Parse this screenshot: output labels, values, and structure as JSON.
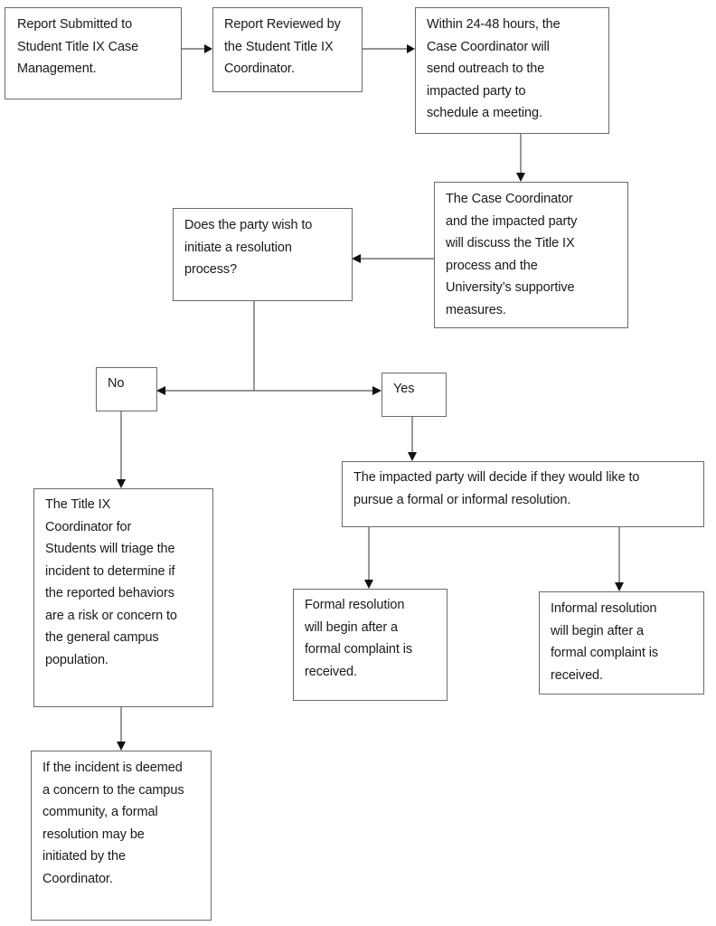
{
  "flowchart": {
    "nodes": {
      "report_submitted": {
        "text": "Report Submitted to\nStudent Title IX Case\nManagement."
      },
      "report_reviewed": {
        "text": "Report Reviewed by\nthe Student Title IX\nCoordinator."
      },
      "outreach": {
        "text": "Within 24-48 hours, the\nCase Coordinator will\nsend outreach to the\nimpacted party to\nschedule a meeting."
      },
      "discuss": {
        "text": "The Case Coordinator\nand the impacted party\nwill discuss the Title IX\nprocess and the\nUniversity’s supportive\nmeasures."
      },
      "decision": {
        "text": "Does the party wish to\ninitiate a resolution\nprocess?"
      },
      "no": {
        "text": "No"
      },
      "yes": {
        "text": "Yes"
      },
      "decide_type": {
        "text": "The impacted party will decide if they would like to\npursue a formal or informal resolution."
      },
      "triage": {
        "text": "The Title IX\nCoordinator for\nStudents will triage the\nincident to determine if\nthe reported behaviors\nare a risk or concern to\nthe general campus\npopulation."
      },
      "concern": {
        "text": "If the incident is deemed\na concern to the campus\ncommunity, a formal\nresolution may be\ninitiated by the\nCoordinator."
      },
      "formal": {
        "text": "Formal resolution\nwill begin after a\nformal complaint is\nreceived."
      },
      "informal": {
        "text": "Informal resolution\nwill begin after a\nformal complaint is\nreceived."
      }
    },
    "edges": [
      {
        "from": "report_submitted",
        "to": "report_reviewed"
      },
      {
        "from": "report_reviewed",
        "to": "outreach"
      },
      {
        "from": "outreach",
        "to": "discuss"
      },
      {
        "from": "discuss",
        "to": "decision"
      },
      {
        "from": "decision",
        "to": "no"
      },
      {
        "from": "decision",
        "to": "yes"
      },
      {
        "from": "no",
        "to": "triage"
      },
      {
        "from": "triage",
        "to": "concern"
      },
      {
        "from": "yes",
        "to": "decide_type"
      },
      {
        "from": "decide_type",
        "to": "formal"
      },
      {
        "from": "decide_type",
        "to": "informal"
      }
    ]
  }
}
